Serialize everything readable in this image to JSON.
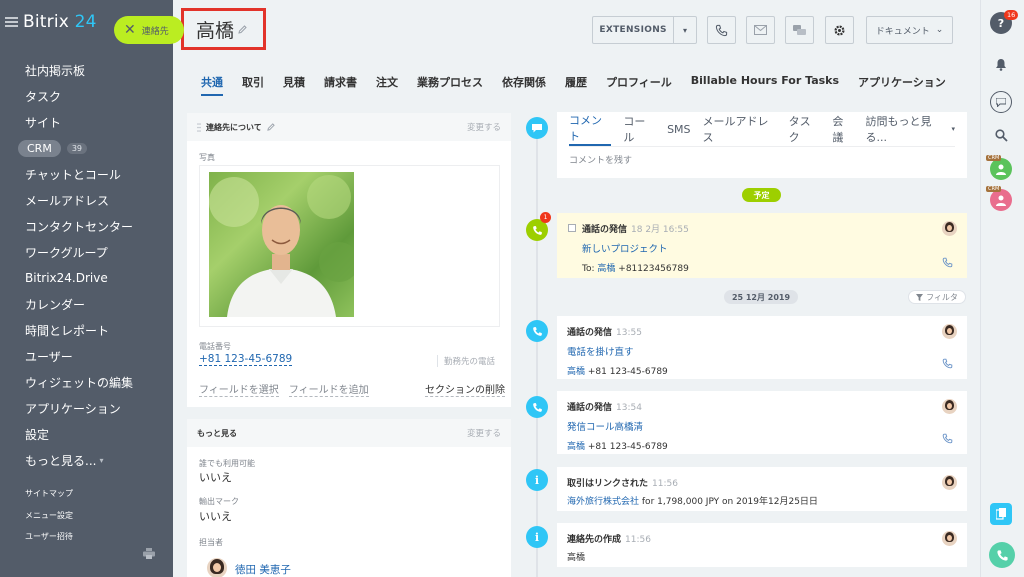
{
  "sidebar": {
    "logo_text": "Bitrix",
    "logo_num": "24",
    "contact_pill": "連絡先",
    "items": [
      {
        "label": "社内掲示板"
      },
      {
        "label": "タスク"
      },
      {
        "label": "サイト"
      },
      {
        "label": "CRM",
        "count": "39"
      },
      {
        "label": "チャットとコール"
      },
      {
        "label": "メールアドレス"
      },
      {
        "label": "コンタクトセンター"
      },
      {
        "label": "ワークグループ"
      },
      {
        "label": "Bitrix24.Drive"
      },
      {
        "label": "カレンダー"
      },
      {
        "label": "時間とレポート"
      },
      {
        "label": "ユーザー"
      },
      {
        "label": "ウィジェットの編集"
      },
      {
        "label": "アプリケーション"
      },
      {
        "label": "設定"
      },
      {
        "label": "もっと見る..."
      }
    ],
    "sitemap": "サイトマップ",
    "menu_settings": "メニュー設定",
    "invite_users": "ユーザー招待"
  },
  "header": {
    "title": "高橋",
    "extensions_label": "EXTENSIONS",
    "documents_label": "ドキュメント"
  },
  "tabs": [
    "共通",
    "取引",
    "見積",
    "請求書",
    "注文",
    "業務プロセス",
    "依存関係",
    "履歴",
    "プロフィール",
    "Billable Hours For Tasks",
    "アプリケーション"
  ],
  "about_card": {
    "title": "連絡先について",
    "change": "変更する",
    "photo_label": "写真",
    "phone_label": "電話番号",
    "phone_value": "+81 123-45-6789",
    "phone_type": "勤務先の電話",
    "select_field": "フィールドを選択",
    "add_field": "フィールドを追加",
    "delete_section": "セクションの削除"
  },
  "more_card": {
    "title": "もっと見る",
    "change": "変更する",
    "available_label": "誰でも利用可能",
    "available_value": "いいえ",
    "export_label": "輸出マーク",
    "export_value": "いいえ",
    "assignee_label": "担当者",
    "assignee_name": "徳田 美恵子"
  },
  "composer": {
    "tabs": [
      "コメント",
      "コール",
      "SMS",
      "メールアドレス",
      "タスク",
      "会議",
      "訪問もっと見る..."
    ],
    "placeholder": "コメントを残す"
  },
  "timeline": {
    "planned_label": "予定",
    "date_label": "25 12月 2019",
    "filter_label": "フィルタ",
    "planned_badge": "1",
    "planned_event": {
      "title": "通話の発信",
      "time": "18 2月 16:55",
      "subject": "新しいプロジェクト",
      "to_prefix": "To:",
      "to_name": "高橋",
      "to_phone": "+81123456789"
    },
    "events": [
      {
        "title": "通話の発信",
        "time": "13:55",
        "line1": "電話を掛け直す",
        "name": "高橋",
        "phone": "+81 123-45-6789"
      },
      {
        "title": "通話の発信",
        "time": "13:54",
        "line1": "発信コール高橋清",
        "name": "高橋",
        "phone": "+81 123-45-6789"
      },
      {
        "title": "取引はリンクされた",
        "time": "11:56",
        "link": "海外旅行株式会社",
        "rest": "for 1,798,000 JPY on 2019年12月25日日"
      },
      {
        "title": "連絡先の作成",
        "time": "11:56",
        "line1": "高橋"
      }
    ]
  },
  "right_bar": {
    "notifications_count": "16",
    "crm_badge": "CRM"
  },
  "colors": {
    "sidebar_bg": "#535c69",
    "accent_blue": "#2067b0",
    "timeline_blue": "#2fc6f6",
    "green": "#bbed21",
    "highlight_red": "#e2332a"
  }
}
